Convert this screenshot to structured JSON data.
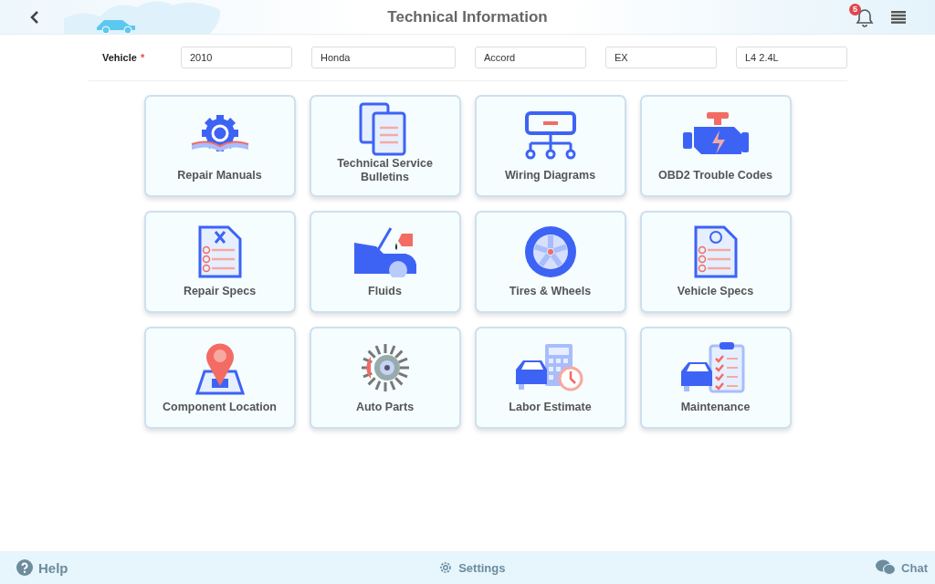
{
  "header": {
    "title": "Technical Information",
    "notification_count": "5"
  },
  "vehicle": {
    "label": "Vehicle",
    "required_mark": "*",
    "fields": [
      {
        "value": "2010"
      },
      {
        "value": "Honda"
      },
      {
        "value": "Accord"
      },
      {
        "value": "EX"
      },
      {
        "value": "L4 2.4L"
      }
    ]
  },
  "tiles": [
    {
      "label": "Repair Manuals",
      "kind": "manual"
    },
    {
      "label": "Technical Service Bulletins",
      "kind": "bulletins"
    },
    {
      "label": "Wiring Diagrams",
      "kind": "wiring"
    },
    {
      "label": "OBD2 Trouble Codes",
      "kind": "engine"
    },
    {
      "label": "Repair Specs",
      "kind": "specs"
    },
    {
      "label": "Fluids",
      "kind": "fluids"
    },
    {
      "label": "Tires & Wheels",
      "kind": "wheel"
    },
    {
      "label": "Vehicle Specs",
      "kind": "vspecs"
    },
    {
      "label": "Component Location",
      "kind": "location"
    },
    {
      "label": "Auto Parts",
      "kind": "parts"
    },
    {
      "label": "Labor Estimate",
      "kind": "labor"
    },
    {
      "label": "Maintenance",
      "kind": "maintenance"
    }
  ],
  "footer": {
    "help": "Help",
    "settings": "Settings",
    "chat": "Chat"
  }
}
